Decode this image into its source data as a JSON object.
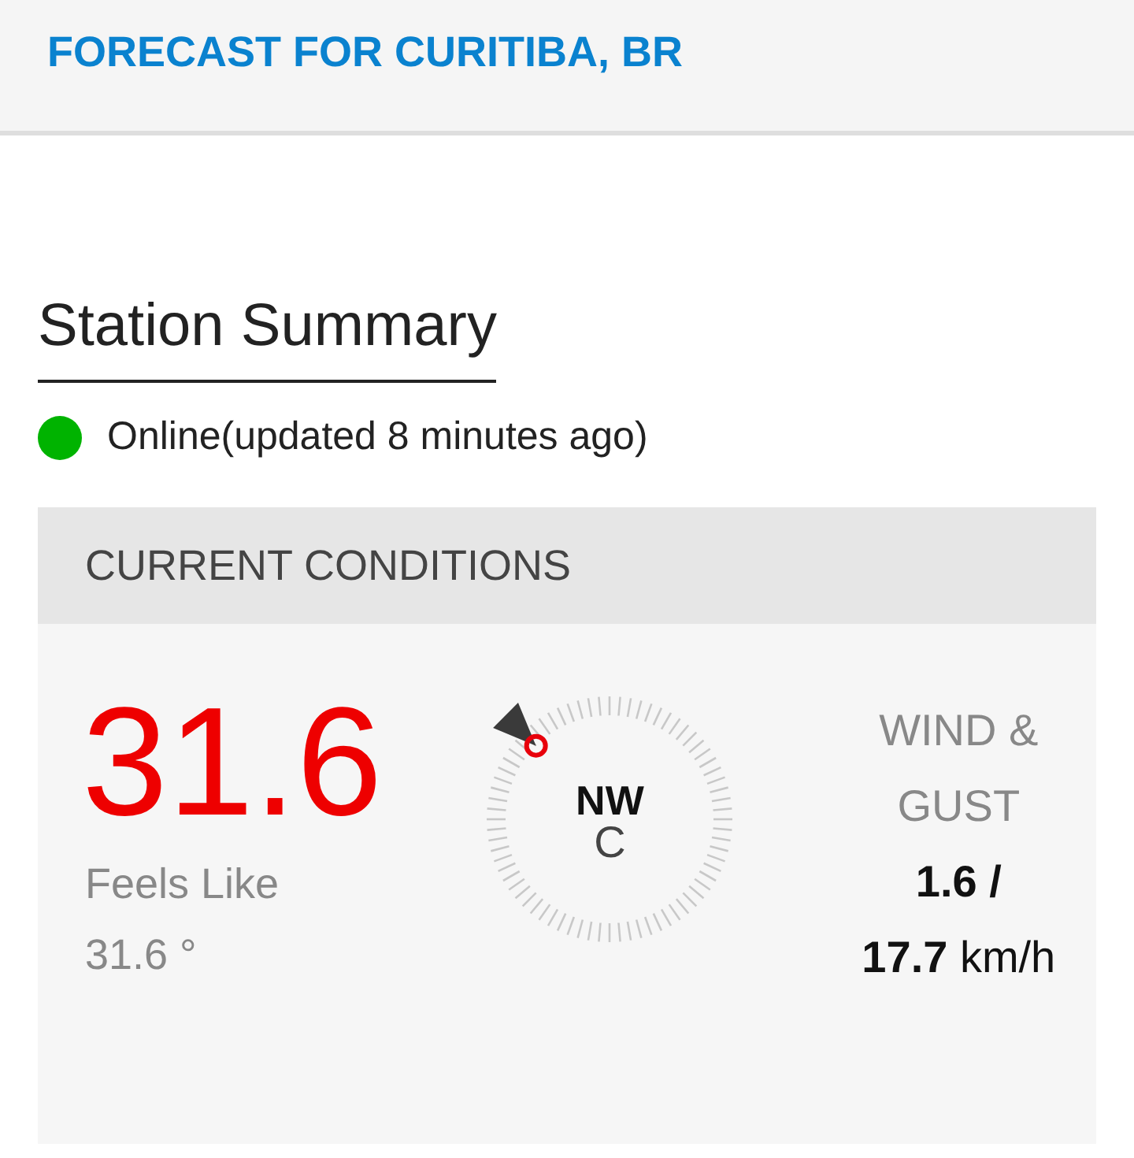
{
  "header": {
    "title": "FORECAST FOR CURITIBA, BR"
  },
  "station": {
    "heading": "Station Summary",
    "status": {
      "online": true,
      "text": "Online(updated 8 minutes ago)"
    }
  },
  "conditions": {
    "heading": "CURRENT CONDITIONS",
    "temperature": "31.6",
    "feels_like_label": "Feels Like",
    "feels_like_value": "31.6 °",
    "compass": {
      "direction": "NW",
      "unit": "C"
    },
    "wind": {
      "label": "WIND & GUST",
      "line_1": "1.6  /",
      "line_2": "**17.7** km/h"
    }
  }
}
